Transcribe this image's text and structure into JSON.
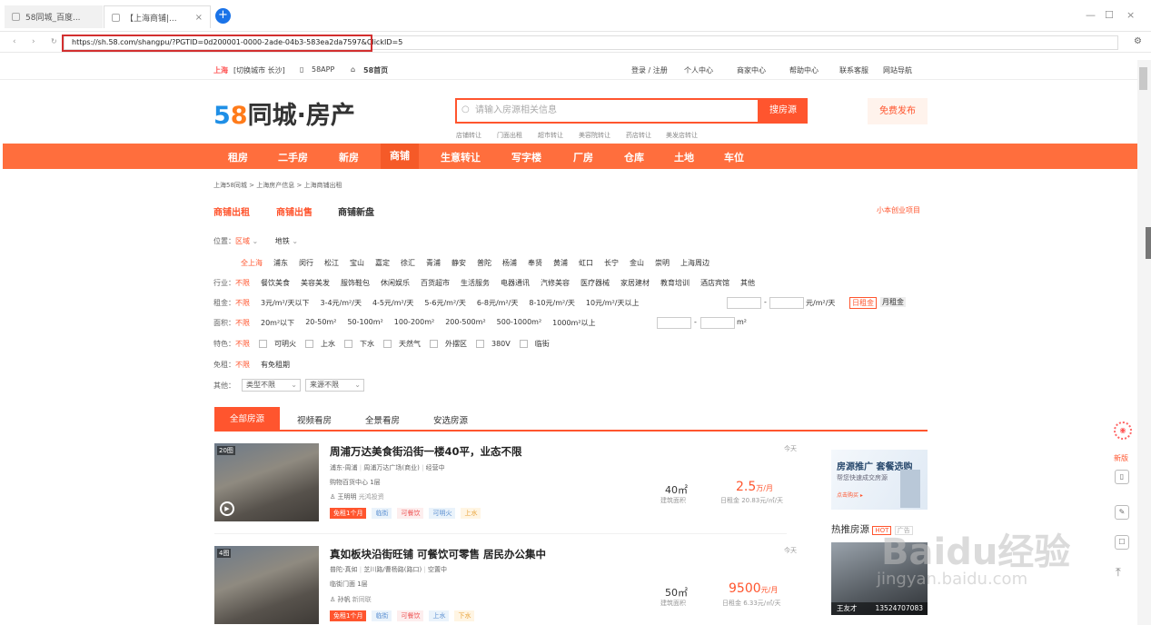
{
  "browser": {
    "tabs": [
      {
        "title": "58同城_百度..."
      },
      {
        "title": "【上海商铺|..."
      }
    ],
    "new_tab": "+",
    "url": "https://sh.58.com/shangpu/?PGTID=0d200001-0000-2ade-04b3-583ea2da7597&ClickID=5",
    "win_controls": [
      "—",
      "☐",
      "×"
    ],
    "nav_icons": [
      "‹",
      "›",
      "↻"
    ]
  },
  "topbar": {
    "city": "上海",
    "switch": "[切换城市 长沙]",
    "app": "58APP",
    "home": "58首页",
    "right": [
      "登录 / 注册",
      "个人中心",
      "商家中心",
      "帮助中心",
      "联系客服",
      "网站导航"
    ]
  },
  "logo": {
    "part1": "5",
    "part2": "8",
    "part3": "同城·房产"
  },
  "search": {
    "placeholder": "请输入房源相关信息",
    "button": "搜房源",
    "publish": "免费发布",
    "hot": [
      "店铺转让",
      "门面出租",
      "超市转让",
      "美容院转让",
      "药店转让",
      "美发店转让"
    ]
  },
  "nav": [
    "租房",
    "二手房",
    "新房",
    "商铺",
    "生意转让",
    "写字楼",
    "厂房",
    "仓库",
    "土地",
    "车位"
  ],
  "breadcrumb": "上海58同城 > 上海房产信息 > 上海商铺出租",
  "subtabs": {
    "items": [
      "商铺出租",
      "商铺出售",
      "商铺新盘"
    ],
    "right": "小本创业项目"
  },
  "filters": {
    "location": {
      "label": "位置：",
      "a": "区域",
      "b": "地铁"
    },
    "districts": [
      "全上海",
      "浦东",
      "闵行",
      "松江",
      "宝山",
      "嘉定",
      "徐汇",
      "青浦",
      "静安",
      "普陀",
      "杨浦",
      "奉贤",
      "黄浦",
      "虹口",
      "长宁",
      "金山",
      "崇明",
      "上海周边"
    ],
    "industry": {
      "label": "行业：",
      "opts": [
        "不限",
        "餐饮美食",
        "美容美发",
        "服饰鞋包",
        "休闲娱乐",
        "百货超市",
        "生活服务",
        "电器通讯",
        "汽修美容",
        "医疗器械",
        "家居建材",
        "教育培训",
        "酒店宾馆",
        "其他"
      ]
    },
    "rent": {
      "label": "租金：",
      "opts": [
        "不限",
        "3元/m²/天以下",
        "3-4元/m²/天",
        "4-5元/m²/天",
        "5-6元/m²/天",
        "6-8元/m²/天",
        "8-10元/m²/天",
        "10元/m²/天以上"
      ],
      "unit": "元/m²/天",
      "day": "日租金",
      "month": "月租金"
    },
    "area": {
      "label": "面积：",
      "opts": [
        "不限",
        "20m²以下",
        "20-50m²",
        "50-100m²",
        "100-200m²",
        "200-500m²",
        "500-1000m²",
        "1000m²以上"
      ],
      "unit": "m²"
    },
    "feature": {
      "label": "特色：",
      "opts": [
        "不限",
        "可明火",
        "上水",
        "下水",
        "天然气",
        "外摆区",
        "380V",
        "临街"
      ]
    },
    "free": {
      "label": "免租：",
      "opts": [
        "不限",
        "有免租期"
      ]
    },
    "other": {
      "label": "其他：",
      "type": "类型不限",
      "source": "来源不限"
    }
  },
  "listtabs": [
    "全部房源",
    "视频看房",
    "全景看房",
    "安选房源"
  ],
  "listings": [
    {
      "count": "20图",
      "title": "周浦万达美食街沿街一楼40平，业态不限",
      "loc": "浦东-周浦",
      "addr": "周浦万达广场(商业)",
      "state": "经营中",
      "type": "购物百货中心 1层",
      "agent": "王明明",
      "company": "光鸿投资",
      "tags": [
        "免租1个月",
        "临街",
        "可餐饮",
        "可明火",
        "上水"
      ],
      "time": "今天",
      "area": "40㎡",
      "area_label": "建筑面积",
      "price": "2.5",
      "price_unit": "万/月",
      "daily": "日租金 20.83元/㎡/天"
    },
    {
      "count": "4图",
      "title": "真如板块沿街旺铺 可餐饮可零售 居民办公集中",
      "loc": "普陀-真如",
      "addr": "芝川路/曹杨路(路口)",
      "state": "空置中",
      "type": "临街门面 1层",
      "agent": "孙帆",
      "company": "新同联",
      "tags": [
        "免租1个月",
        "临街",
        "可餐饮",
        "上水",
        "下水"
      ],
      "time": "今天",
      "area": "50㎡",
      "area_label": "建筑面积",
      "price": "9500",
      "price_unit": "元/月",
      "daily": "日租金 6.33元/㎡/天"
    }
  ],
  "ad": {
    "title": "房源推广 套餐选购",
    "sub": "帮您快速成交房源",
    "link": "点击购买 ▸"
  },
  "hot": {
    "label": "热推房源",
    "badge": "HOT",
    "ad": "广告",
    "name": "王友才",
    "phone": "13524707083"
  },
  "sidebar": {
    "new": "新版"
  },
  "watermark": {
    "text": "Baidu经验",
    "url": "jingyan.baidu.com"
  }
}
